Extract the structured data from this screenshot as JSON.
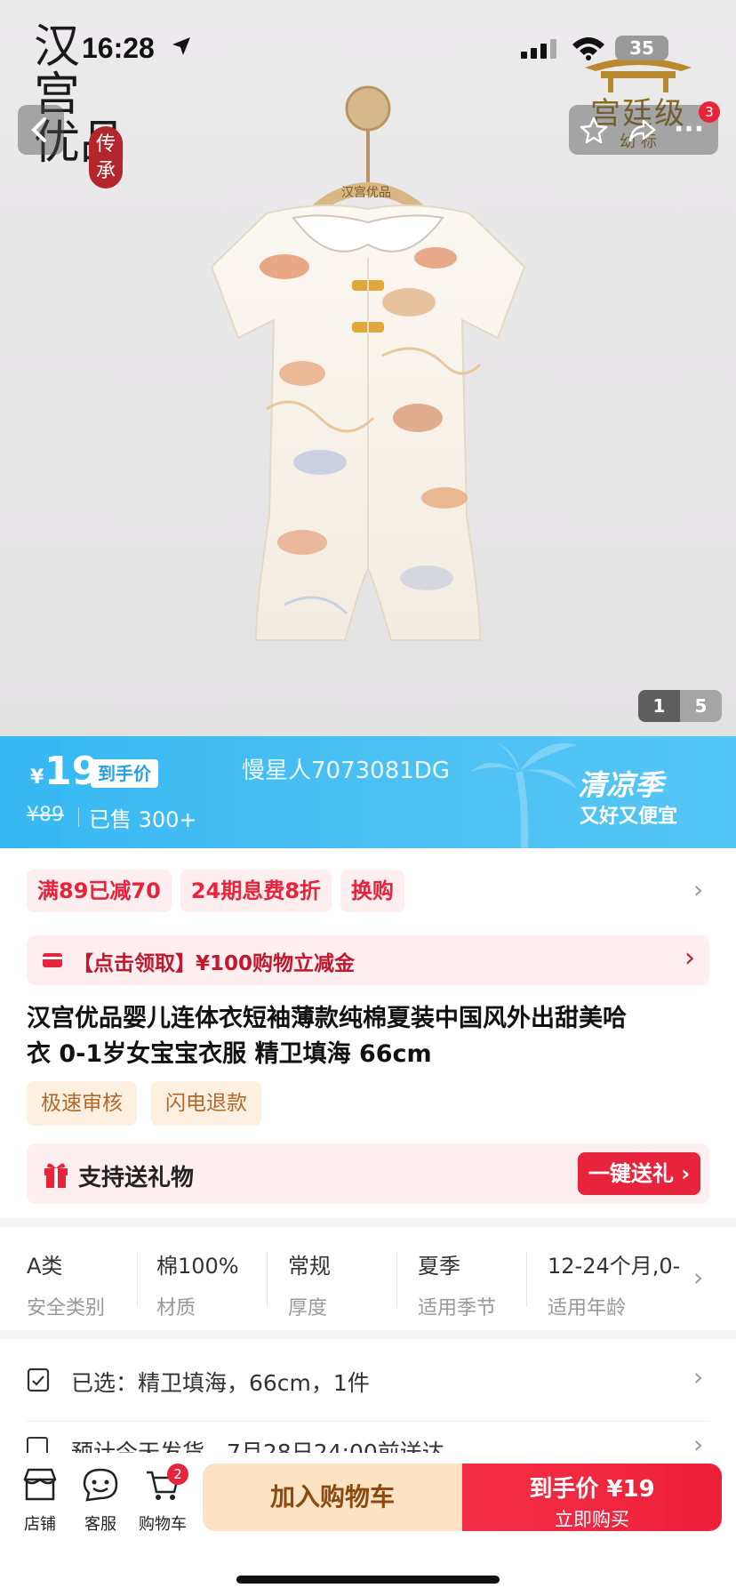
{
  "status_bar": {
    "time": "16:28",
    "battery": "35"
  },
  "hero": {
    "brand_logo_chars": [
      "汉",
      "宫",
      "优",
      "品"
    ],
    "brand_seal": "传承",
    "hanger_label": "汉宫优品",
    "palace_badge": "宫廷级",
    "palace_badge_sub": "幼 标",
    "notification_count": "3",
    "image_index": "1",
    "image_total": "5"
  },
  "price": {
    "currency": "¥",
    "amount": "19",
    "final_price_tag": "到手价",
    "original_price": "¥89",
    "sold": "已售 300+",
    "watermark": "慢星人7073081DG",
    "campaign_title": "清凉季",
    "campaign_sub": "又好又便宜"
  },
  "coupons": [
    "满89已减70",
    "24期息费8折",
    "换购"
  ],
  "voucher": {
    "text": "【点击领取】¥100购物立减金"
  },
  "product": {
    "title_line1": "汉宫优品婴儿连体衣短袖薄款纯棉夏装中国风外出甜美哈",
    "title_line2": "衣 0-1岁女宝宝衣服 精卫填海 66cm"
  },
  "service_tags": [
    "极速审核",
    "闪电退款"
  ],
  "gift": {
    "label": "支持送礼物",
    "button": "一键送礼"
  },
  "attributes": [
    {
      "value": "A类",
      "key": "安全类别"
    },
    {
      "value": "棉100%",
      "key": "材质"
    },
    {
      "value": "常规",
      "key": "厚度"
    },
    {
      "value": "夏季",
      "key": "适用季节"
    },
    {
      "value": "12-24个月,0-",
      "key": "适用年龄"
    }
  ],
  "selection": {
    "text": "已选：精卫填海，66cm，1件"
  },
  "shipping": {
    "text": "预计今天发货，7月28日24:00前送达"
  },
  "bottom_bar": {
    "store": "店铺",
    "service": "客服",
    "cart": "购物车",
    "cart_count": "2",
    "add_to_cart": "加入购物车",
    "buy_price_label": "到手价",
    "buy_price": "¥19",
    "buy_now": "立即购买"
  },
  "colors": {
    "accent_red": "#e8243c",
    "price_band_blue": "#3fbaf3",
    "add_cart_bg": "#fde3c4",
    "add_cart_text": "#8a4a10"
  }
}
